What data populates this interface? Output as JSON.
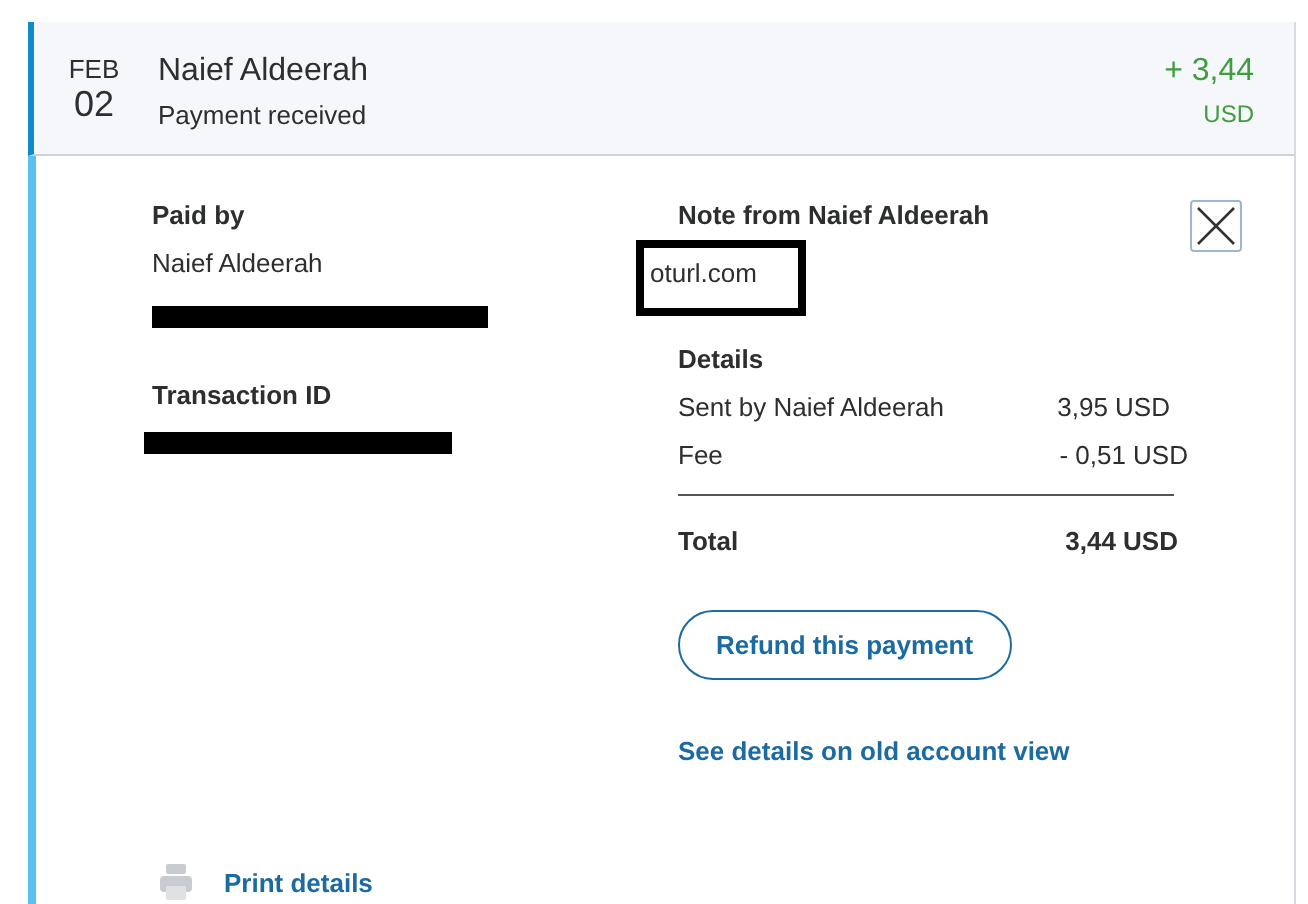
{
  "transaction": {
    "month": "FEB",
    "day": "02",
    "name": "Naief Aldeerah",
    "status": "Payment received",
    "amount": "+ 3,44",
    "currency": "USD",
    "expanded": true
  },
  "paid_by": {
    "heading": "Paid by",
    "name": "Naief Aldeerah",
    "email_redacted": true
  },
  "transaction_id": {
    "heading": "Transaction ID",
    "value_redacted": true
  },
  "note": {
    "heading": "Note from Naief Aldeerah",
    "text": "oturl.com",
    "framed": true
  },
  "details": {
    "heading": "Details",
    "rows": [
      {
        "label": "Sent by Naief Aldeerah",
        "value": "3,95 USD"
      },
      {
        "label": "Fee",
        "value": "- 0,51 USD"
      }
    ],
    "total": {
      "label": "Total",
      "value": "3,44 USD"
    }
  },
  "refund_button": "Refund this payment",
  "old_view_link": "See details on old account view",
  "print_link": "Print details"
}
